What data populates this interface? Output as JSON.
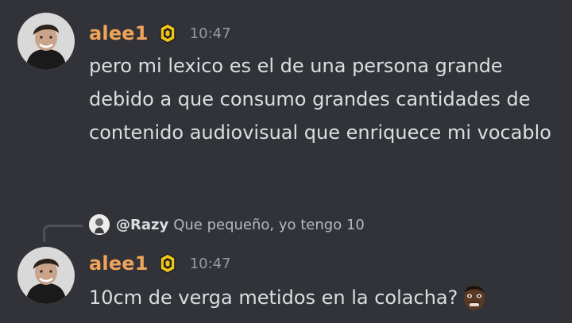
{
  "messages": [
    {
      "author": "alee1",
      "timestamp": "10:47",
      "text": "pero mi lexico es el de una persona grande debido a que consumo grandes cantidades de contenido audiovisual que enriquece mi vocablo"
    },
    {
      "author": "alee1",
      "timestamp": "10:47",
      "reply": {
        "author": "@Razy",
        "text": "Que pequeño, yo tengo 10"
      },
      "text": "10cm de verga metidos en la colacha?",
      "emoji": "dark-skinned-face-emoji"
    }
  ],
  "colors": {
    "background": "#313338",
    "username": "#f0a35a",
    "timestamp": "#949ba4",
    "message_text": "#dbdee1",
    "reply_text": "#b5bac1",
    "badge": "#f0c419"
  },
  "icons": {
    "server_badge": "server-tag-badge-icon",
    "emoji": "face-emoji-icon"
  }
}
